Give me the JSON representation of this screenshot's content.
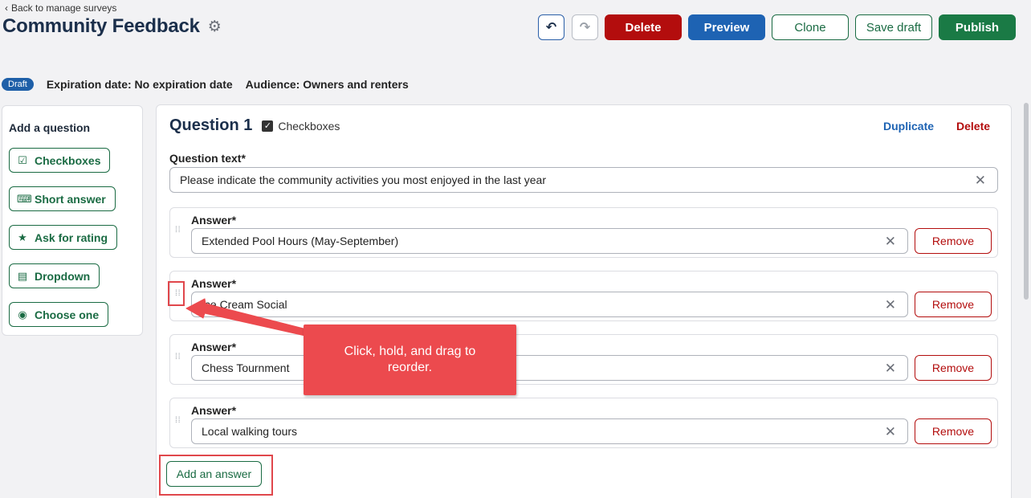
{
  "header": {
    "back_label": "Back to manage surveys",
    "title": "Community Feedback",
    "gear_icon": "gear-icon"
  },
  "toolbar": {
    "undo_icon": "undo-icon",
    "redo_icon": "redo-icon",
    "delete_label": "Delete",
    "preview_label": "Preview",
    "clone_label": "Clone",
    "save_draft_label": "Save draft",
    "publish_label": "Publish"
  },
  "status": {
    "badge": "Draft",
    "expiration": "Expiration date: No expiration date",
    "audience": "Audience: Owners and renters"
  },
  "sidebar": {
    "heading": "Add a question",
    "items": [
      {
        "label": "Checkboxes",
        "icon": "checkbox-icon"
      },
      {
        "label": "Short answer",
        "icon": "short-answer-icon"
      },
      {
        "label": "Ask for rating",
        "icon": "star-icon"
      },
      {
        "label": "Dropdown",
        "icon": "dropdown-icon"
      },
      {
        "label": "Choose one",
        "icon": "radio-icon"
      }
    ]
  },
  "question": {
    "title": "Question 1",
    "type_label": "Checkboxes",
    "duplicate_label": "Duplicate",
    "delete_label": "Delete",
    "text_label": "Question text*",
    "text_value": "Please indicate the community activities you most enjoyed in the last year",
    "answer_label": "Answer*",
    "remove_label": "Remove",
    "answers": [
      "Extended Pool Hours (May-September)",
      "Ice Cream Social",
      "Chess Tournment",
      "Local walking tours"
    ],
    "add_answer_label": "Add an answer"
  },
  "annotation": {
    "callout_text": "Click, hold, and drag to reorder.",
    "accent_color": "#ec4a4e"
  }
}
